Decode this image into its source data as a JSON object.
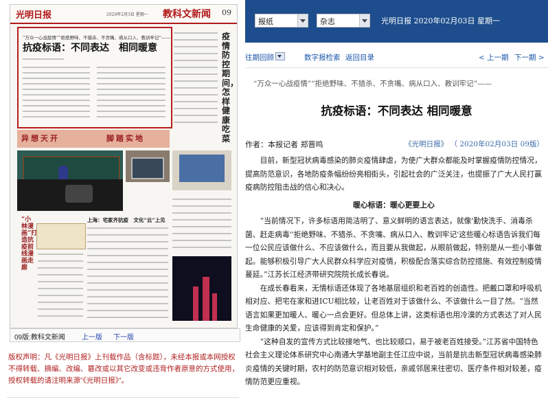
{
  "newspaper": {
    "logo": "光明日报",
    "date_line": "2020年2月3日 星期一",
    "section": "教科文新闻",
    "page_no": "09",
    "headline_kicker": "“万众一心战疫情”“拒绝野味、不猎杀、不贪嘴、病从口入、教训牢记”——",
    "headline": "抗疫标语：不同表达　相同暖意",
    "side_headline": "疫情防控期间，怎样健康吃菜",
    "banner_left": "异想天开",
    "banner_right": "脚踏实地",
    "sub_headline": "上海：宅家齐抗疫　文化“云”上见",
    "vertical_red": "“小林漫画”打造抗疫前线漫画走廊"
  },
  "left_footer": {
    "edition": "09版:教科文新闻",
    "prev": "上一版",
    "next": "下一版"
  },
  "copyright": "版权声明：凡《光明日报》上刊载作品（含标题），未经本报或本网授权不得转载、摘编、改编、篡改或以其它改变或违背作者原意的方式使用，授权转载的请注明来源”《光明日报》”。",
  "topbar": {
    "select1": "报纸",
    "select2": "杂志",
    "date": "光明日报 2020年02月03日 星期一"
  },
  "nav": {
    "back": "往期回顾",
    "search": "数字报检索",
    "home": "返回目录",
    "prev": "< 上一期",
    "next": "下一期 >"
  },
  "article": {
    "kicker": "“万众一心战疫情”“拒绝野味、不猎杀、不贪嘴、病从口入、教训牢记”——",
    "title": "抗疫标语：不同表达 相同暖意",
    "author": "作者：本报记者 郑晋鸣",
    "source": "《光明日报》 （ 2020年02月03日 09版）",
    "p1": "目前，新型冠状病毒感染的肺炎疫情肆虐，为使广大群众都能及时掌握疫情防控情况，提高防范意识，各地防疫条幅纷纷亮相街头，引起社会的广泛关注，也提振了广大人民打赢疫病防控阻击战的信心和决心。",
    "subhead": "暖心标语：暖心更要上心",
    "p2": "“当前情况下，许多标语用简洁明了、意义鲜明的语言表达，就像'勤快洗手、消毒杀菌、赶走病毒''拒绝野味、不猎杀、不贪嘴、病从口入、教训牢记'这些暖心标语告诉我们每一位公民应该做什么、不应该做什么，而且要从我做起，从眼前做起，特别是从一些小事做起。能够积极引导广大人民群众科学应对疫情，积极配合落实综合防控措施、有效控制疫情蔓延。”江苏长江经济带研究院院长成长春说。",
    "p3": "在成长春看来，无情标语还体现了各地基层组织和老百姓的创造性。把戴口罩和呼吸机相对应、把宅在家和进ICU相比较，让老百姓对于该做什么、不该做什么一目了然。“当然语言如果更加暖人、暖心一点会更好。但总体上讲，这类标语也用冷漠的方式表达了对人民生命健康的关爱，应该得到肯定和保护。”",
    "p4": "“这种自发的宣传方式比较接地气、也比较顺口，易于被老百姓接受。”江苏省中国特色社会主义理论体系研究中心南通大学基地副主任江应中说，当前是抗击新型冠状病毒感染肺炎疫情的关键时期，农村的防范意识相对较低，亲戚邻居来往密切、医疗条件相对较差，疫情防范更应重视。"
  }
}
